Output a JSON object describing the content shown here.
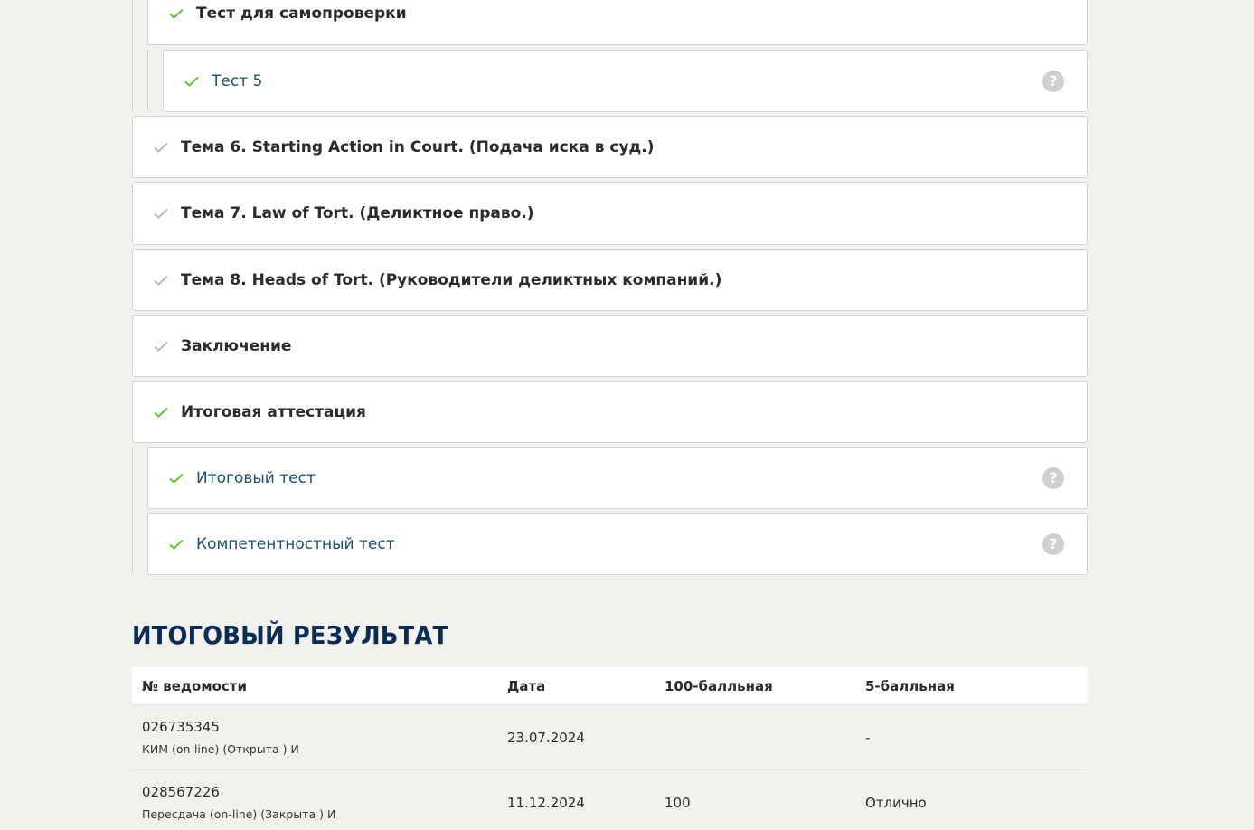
{
  "colors": {
    "check_green": "#6fbf3c",
    "check_gray": "#b9b9b9",
    "title_navy": "#0c2c53",
    "link_blue": "#1f4e6f"
  },
  "outline": {
    "items": [
      {
        "label": "Тест для самопроверки",
        "status": "green",
        "style": "bold",
        "help": false
      },
      {
        "label": "Тест 5",
        "status": "green",
        "style": "link",
        "help": true,
        "help_label": "?"
      },
      {
        "label": "Тема 6. Starting Action in Court. (Подача иска в суд.)",
        "status": "gray",
        "style": "bold",
        "help": false
      },
      {
        "label": "Тема 7. Law of Tort. (Деликтное право.)",
        "status": "gray",
        "style": "bold",
        "help": false
      },
      {
        "label": "Тема 8. Heads of Tort. (Руководители деликтных компаний.)",
        "status": "gray",
        "style": "bold",
        "help": false
      },
      {
        "label": "Заключение",
        "status": "gray",
        "style": "bold",
        "help": false
      },
      {
        "label": "Итоговая аттестация",
        "status": "green",
        "style": "bold",
        "help": false
      },
      {
        "label": "Итоговый тест",
        "status": "green",
        "style": "link",
        "help": true,
        "help_label": "?"
      },
      {
        "label": "Компетентностный тест",
        "status": "green",
        "style": "link",
        "help": true,
        "help_label": "?"
      }
    ]
  },
  "results": {
    "title": "ИТОГОВЫЙ РЕЗУЛЬТАТ",
    "headers": [
      "№ ведомости",
      "Дата",
      "100-балльная",
      "5-балльная"
    ],
    "rows": [
      {
        "number": "026735345",
        "type": "КИМ (on-line) (Открыта ) И",
        "date": "23.07.2024",
        "score100": "",
        "score5": "-"
      },
      {
        "number": "028567226",
        "type": "Пересдача (on-line) (Закрыта ) И",
        "date": "11.12.2024",
        "score100": "100",
        "score5": "Отлично"
      }
    ]
  }
}
